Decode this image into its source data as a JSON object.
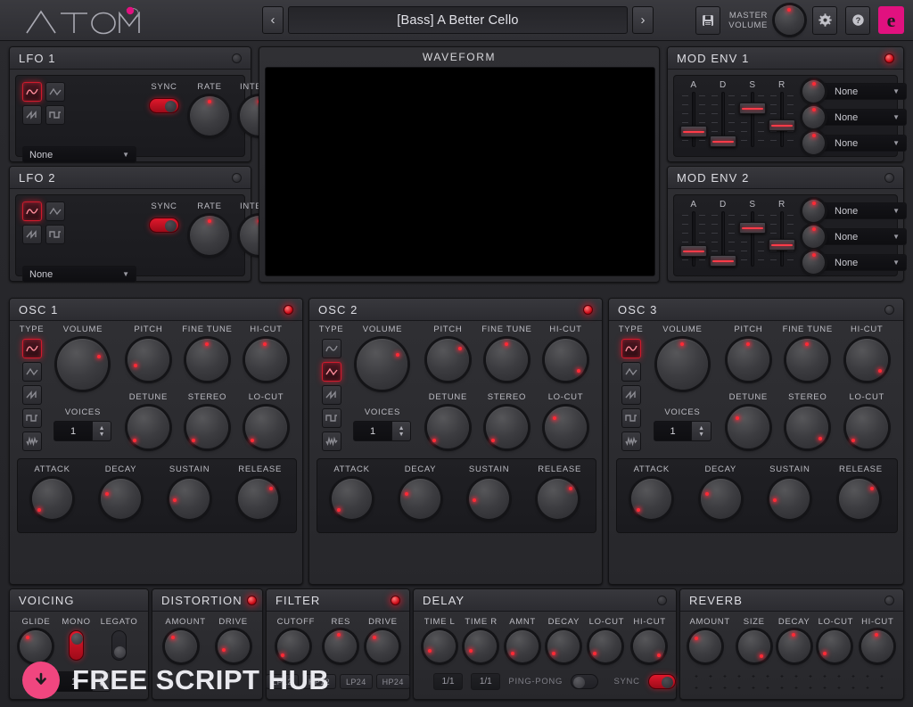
{
  "app": {
    "brand": "ATOM",
    "preset_name": "[Bass] A Better Cello",
    "prev_label": "‹",
    "next_label": "›",
    "save_icon": "save-icon",
    "master_volume_line1": "MASTER",
    "master_volume_line2": "VOLUME",
    "settings_icon": "gear-icon",
    "help_icon": "question-icon",
    "vendor_logo": "e"
  },
  "lfo": [
    {
      "title": "LFO 1",
      "power": "on",
      "sync_label": "SYNC",
      "sync_on": true,
      "rate_label": "RATE",
      "intensity_label": "INTENSITY",
      "shape_selected": 0,
      "shapes": [
        "sine-icon",
        "triangle-icon",
        "saw-icon",
        "square-icon"
      ],
      "destination": "None"
    },
    {
      "title": "LFO 2",
      "power": "off",
      "sync_label": "SYNC",
      "sync_on": true,
      "rate_label": "RATE",
      "intensity_label": "INTENSITY",
      "shape_selected": 0,
      "shapes": [
        "sine-icon",
        "triangle-icon",
        "saw-icon",
        "square-icon"
      ],
      "destination": "None"
    }
  ],
  "waveform": {
    "title": "WAVEFORM"
  },
  "mod_env": [
    {
      "title": "MOD ENV 1",
      "power": "on",
      "slider_labels": [
        "A",
        "D",
        "S",
        "R"
      ],
      "slider_values": [
        22,
        8,
        78,
        38
      ],
      "destinations": [
        "None",
        "None",
        "None"
      ]
    },
    {
      "title": "MOD ENV 2",
      "power": "off",
      "slider_labels": [
        "A",
        "D",
        "S",
        "R"
      ],
      "slider_values": [
        22,
        8,
        78,
        38
      ],
      "destinations": [
        "None",
        "None",
        "None"
      ]
    }
  ],
  "osc": [
    {
      "title": "OSC 1",
      "power": "on",
      "type_label": "TYPE",
      "types": [
        "sine-icon",
        "triangle-icon",
        "saw-icon",
        "square-icon",
        "noise-icon"
      ],
      "type_selected": 0,
      "voices_label": "VOICES",
      "voices_value": "1",
      "knobs": [
        {
          "label": "VOLUME",
          "value": 72
        },
        {
          "label": "PITCH",
          "value": 22
        },
        {
          "label": "FINE TUNE",
          "value": 50
        },
        {
          "label": "HI-CUT",
          "value": 48
        },
        {
          "label": "DETUNE",
          "value": 8
        },
        {
          "label": "STEREO",
          "value": 8
        },
        {
          "label": "LO-CUT",
          "value": 8
        }
      ],
      "env_labels": [
        "ATTACK",
        "DECAY",
        "SUSTAIN",
        "RELEASE"
      ],
      "env_values": [
        6,
        16,
        12,
        88
      ]
    },
    {
      "title": "OSC 2",
      "power": "on",
      "type_label": "TYPE",
      "types": [
        "sine-icon",
        "triangle-icon",
        "saw-icon",
        "square-icon",
        "noise-icon"
      ],
      "type_selected": 1,
      "voices_label": "VOICES",
      "voices_value": "1",
      "knobs": [
        {
          "label": "VOLUME",
          "value": 70
        },
        {
          "label": "PITCH",
          "value": 66
        },
        {
          "label": "FINE TUNE",
          "value": 50
        },
        {
          "label": "HI-CUT",
          "value": 85
        },
        {
          "label": "DETUNE",
          "value": 7
        },
        {
          "label": "STEREO",
          "value": 7
        },
        {
          "label": "LO-CUT",
          "value": 18
        }
      ],
      "env_labels": [
        "ATTACK",
        "DECAY",
        "SUSTAIN",
        "RELEASE"
      ],
      "env_values": [
        6,
        16,
        12,
        88
      ]
    },
    {
      "title": "OSC 3",
      "power": "off",
      "type_label": "TYPE",
      "types": [
        "sine-icon",
        "triangle-icon",
        "saw-icon",
        "square-icon",
        "noise-icon"
      ],
      "type_selected": 0,
      "voices_label": "VOICES",
      "voices_value": "1",
      "knobs": [
        {
          "label": "VOLUME",
          "value": 50
        },
        {
          "label": "PITCH",
          "value": 50
        },
        {
          "label": "FINE TUNE",
          "value": 50
        },
        {
          "label": "HI-CUT",
          "value": 85
        },
        {
          "label": "DETUNE",
          "value": 18
        },
        {
          "label": "STEREO",
          "value": 85
        },
        {
          "label": "LO-CUT",
          "value": 8
        }
      ],
      "env_labels": [
        "ATTACK",
        "DECAY",
        "SUSTAIN",
        "RELEASE"
      ],
      "env_values": [
        6,
        16,
        12,
        88
      ]
    }
  ],
  "voicing": {
    "title": "VOICING",
    "glide_label": "GLIDE",
    "glide_value": 22,
    "mono_label": "MONO",
    "mono_on": true,
    "legato_label": "LEGATO",
    "legato_on": false,
    "poly_label": "POLY",
    "poly_value": "1"
  },
  "distortion": {
    "title": "DISTORTION",
    "power": "on",
    "knobs": [
      {
        "label": "AMOUNT",
        "value": 22
      },
      {
        "label": "DRIVE",
        "value": 14
      }
    ]
  },
  "filter": {
    "title": "FILTER",
    "power": "on",
    "knobs": [
      {
        "label": "CUTOFF",
        "value": 8
      },
      {
        "label": "RES",
        "value": 38
      },
      {
        "label": "DRIVE",
        "value": 22
      }
    ],
    "types": [
      "LP12",
      "HP12",
      "LP24",
      "HP24"
    ],
    "type_selected": 0
  },
  "delay": {
    "title": "DELAY",
    "power": "off",
    "knobs": [
      {
        "label": "TIME L",
        "value": 14
      },
      {
        "label": "TIME R",
        "value": 14
      },
      {
        "label": "AMNT",
        "value": 12
      },
      {
        "label": "DECAY",
        "value": 12
      },
      {
        "label": "LO-CUT",
        "value": 10
      },
      {
        "label": "HI-CUT",
        "value": 85
      }
    ],
    "time_l_value": "1/1",
    "time_r_value": "1/1",
    "pingpong_label": "PING-PONG",
    "pingpong_on": false,
    "sync_label": "SYNC",
    "sync_on": true
  },
  "reverb": {
    "title": "REVERB",
    "power": "off",
    "knobs": [
      {
        "label": "AMOUNT",
        "value": 24
      },
      {
        "label": "SIZE",
        "value": 82
      },
      {
        "label": "DECAY",
        "value": 46
      },
      {
        "label": "LO-CUT",
        "value": 14
      },
      {
        "label": "HI-CUT",
        "value": 42
      }
    ]
  },
  "watermark": {
    "text": "FREE SCRIPT HUB",
    "icon": "download-icon"
  },
  "colors": {
    "accent_red": "#e1142c",
    "brand_pink": "#e1117f",
    "watermark_pink": "#f0467f",
    "panel_bg": "#2c2c31",
    "screen_bg": "#000000"
  }
}
